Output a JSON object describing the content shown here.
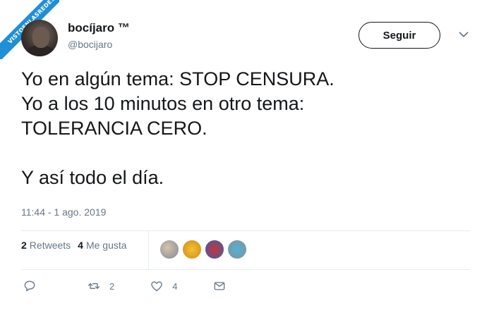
{
  "watermark": {
    "line1": "VISTOENLASREDES",
    "line2": ".com"
  },
  "user": {
    "display_name": "bocíjaro ™",
    "handle": "@bocijaro"
  },
  "follow_button": {
    "label": "Seguir"
  },
  "tweet": {
    "text": "Yo en algún tema: STOP CENSURA.\nYo a los 10 minutos en otro tema:\nTOLERANCIA CERO.\n\nY así todo el día.",
    "timestamp": "11:44 - 1 ago. 2019"
  },
  "stats": {
    "retweets_count": "2",
    "retweets_label": "Retweets",
    "likes_count": "4",
    "likes_label": "Me gusta"
  },
  "actions": {
    "retweet_count": "2",
    "like_count": "4"
  },
  "colors": {
    "text": "#14171a",
    "secondary": "#657786",
    "divider": "#e6ecf0",
    "watermark": "#1f8fd6"
  },
  "icons": [
    "chevron-down-icon",
    "reply-icon",
    "retweet-icon",
    "like-icon",
    "message-icon"
  ]
}
